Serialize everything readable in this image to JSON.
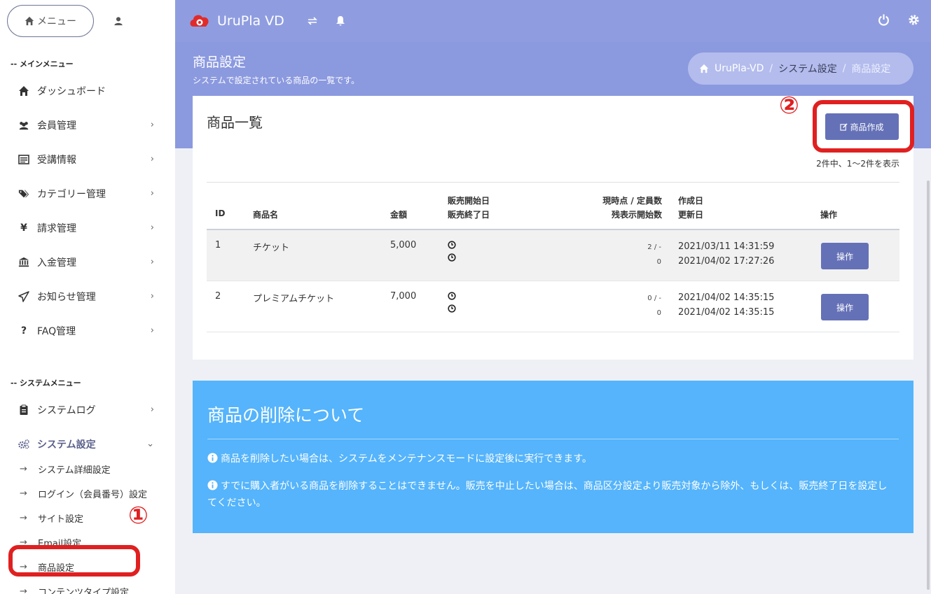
{
  "sidebar": {
    "menu_button": "メニュー",
    "section_main": "-- メインメニュー",
    "section_system": "-- システムメニュー",
    "main_items": [
      {
        "label": "ダッシュボード",
        "icon": "home-icon"
      },
      {
        "label": "会員管理",
        "icon": "users-icon"
      },
      {
        "label": "受講情報",
        "icon": "list-icon"
      },
      {
        "label": "カテゴリー管理",
        "icon": "tags-icon"
      },
      {
        "label": "請求管理",
        "icon": "yen-icon"
      },
      {
        "label": "入金管理",
        "icon": "bank-icon"
      },
      {
        "label": "お知らせ管理",
        "icon": "send-icon"
      },
      {
        "label": "FAQ管理",
        "icon": "question-icon"
      }
    ],
    "system_items": [
      {
        "label": "システムログ",
        "icon": "clipboard-icon"
      },
      {
        "label": "システム設定",
        "icon": "gears-icon"
      }
    ],
    "sub_items": [
      "システム詳細設定",
      "ログイン（会員番号）設定",
      "サイト設定",
      "Email設定",
      "商品設定",
      "コンテンツタイプ設定"
    ],
    "sub_arrow": "→",
    "chevron": "›",
    "chevron_open": "⌄"
  },
  "header": {
    "app_name": "UruPla VD",
    "accent": "#8f9de0"
  },
  "page": {
    "title": "商品設定",
    "subtitle": "システムで設定されている商品の一覧です。",
    "breadcrumb": [
      "UruPla-VD",
      "システム設定",
      "商品設定"
    ],
    "breadcrumb_sep": "/"
  },
  "card": {
    "title": "商品一覧",
    "create_button": "商品作成",
    "count_text": "2件中、1〜2件を表示",
    "headers": {
      "id": "ID",
      "name": "商品名",
      "price": "金額",
      "sale_start": "販売開始日",
      "sale_end": "販売終了日",
      "stock": "現時点 / 定員数",
      "remain": "残表示開始数",
      "created": "作成日",
      "updated": "更新日",
      "op": "操作"
    },
    "rows": [
      {
        "id": "1",
        "name": "チケット",
        "price": "5,000",
        "stock": "2 / -",
        "remain": "0",
        "created": "2021/03/11 14:31:59",
        "updated": "2021/04/02 17:27:26",
        "op": "操作"
      },
      {
        "id": "2",
        "name": "プレミアムチケット",
        "price": "7,000",
        "stock": "0 / -",
        "remain": "0",
        "created": "2021/04/02 14:35:15",
        "updated": "2021/04/02 14:35:15",
        "op": "操作"
      }
    ]
  },
  "info": {
    "title": "商品の削除について",
    "p1": "商品を削除したい場合は、システムをメンテナンスモードに設定後に実行できます。",
    "p2": "すでに購入者がいる商品を削除することはできません。販売を中止したい場合は、商品区分設定より販売対象から除外、もしくは、販売終了日を設定してください。",
    "color": "#55b4fb"
  },
  "annotations": {
    "marker1": "①",
    "marker2": "②",
    "color": "#e02020"
  }
}
